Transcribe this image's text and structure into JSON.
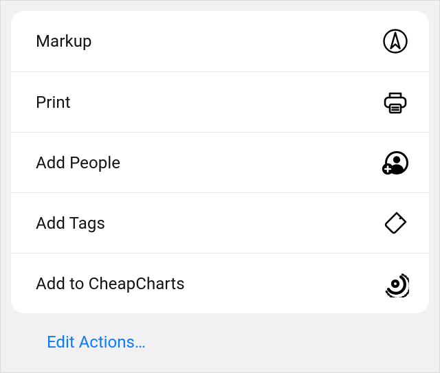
{
  "actions": [
    {
      "id": "markup",
      "label": "Markup",
      "icon": "markup-icon"
    },
    {
      "id": "print",
      "label": "Print",
      "icon": "printer-icon"
    },
    {
      "id": "add-people",
      "label": "Add People",
      "icon": "person-add-icon"
    },
    {
      "id": "add-tags",
      "label": "Add Tags",
      "icon": "tag-icon"
    },
    {
      "id": "add-cheapcharts",
      "label": "Add to CheapCharts",
      "icon": "cheapcharts-icon"
    }
  ],
  "editActionsLabel": "Edit Actions…"
}
